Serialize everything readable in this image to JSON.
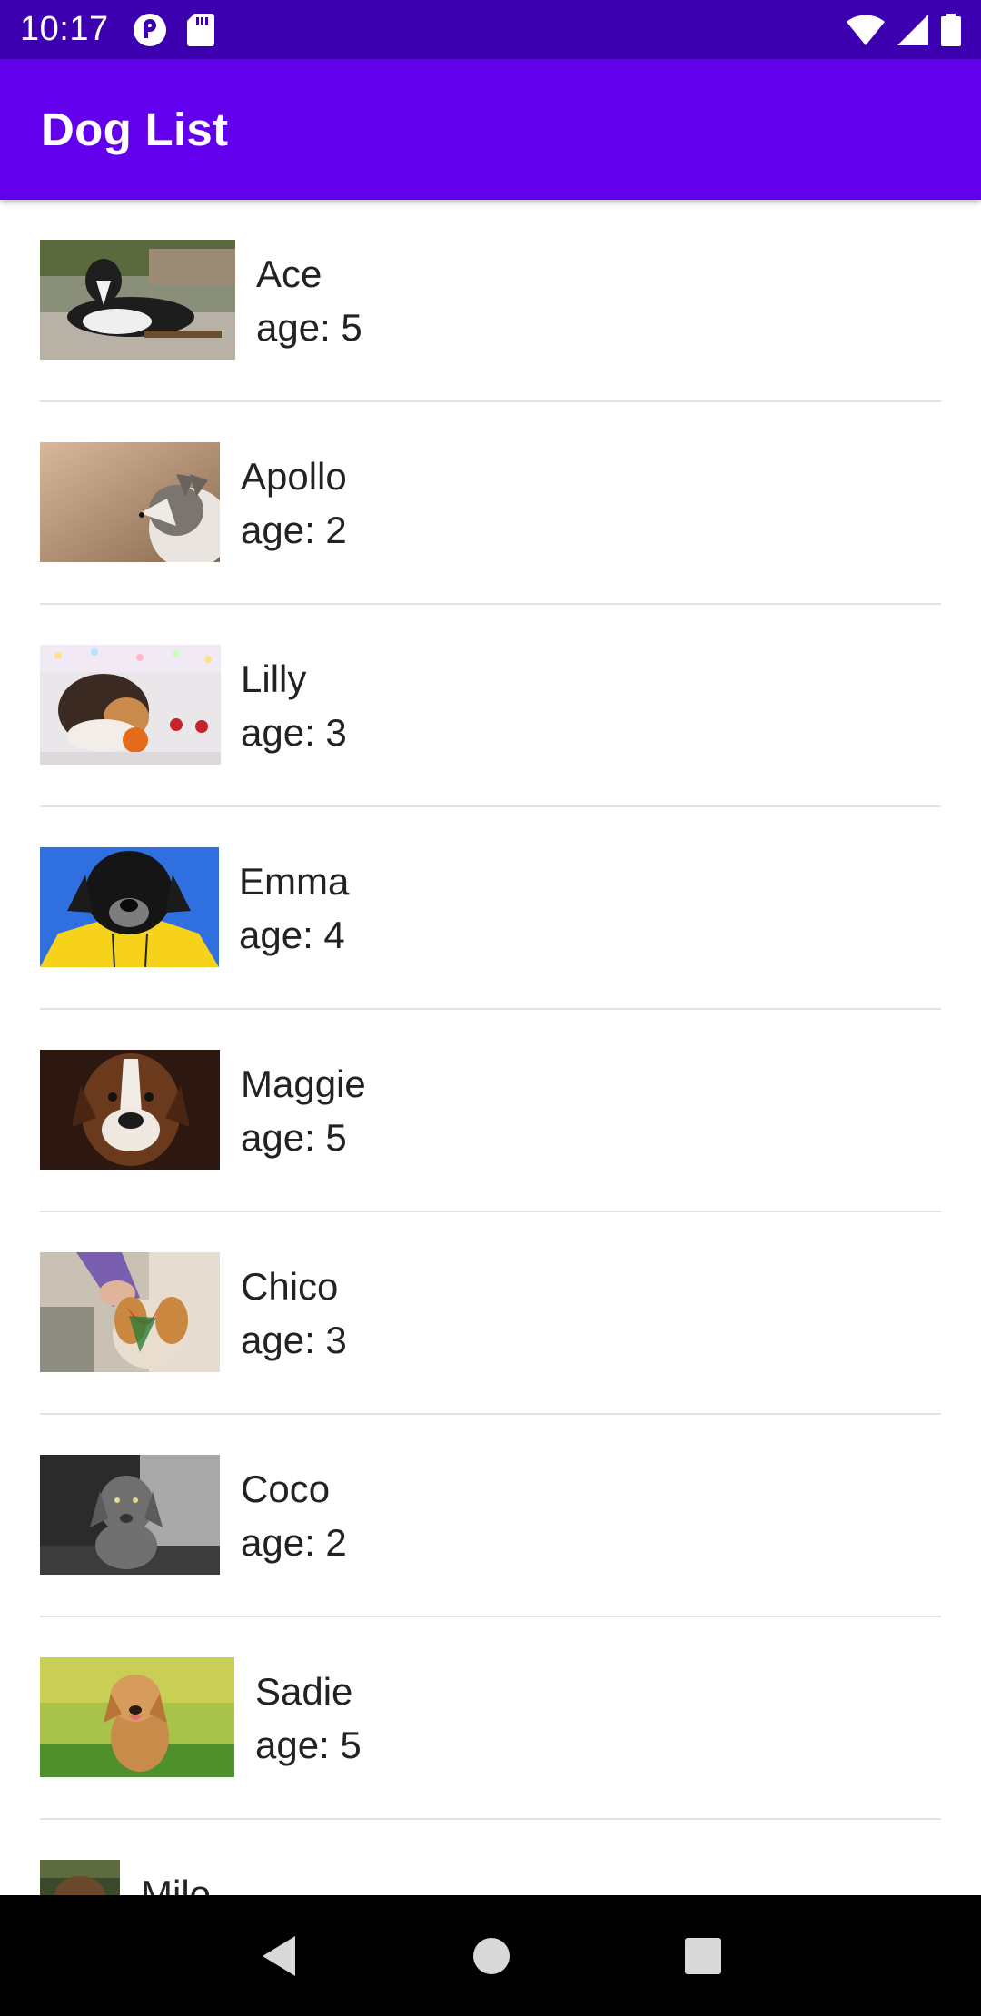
{
  "status_bar": {
    "time": "10:17",
    "icons": [
      "pocket-casts-icon",
      "sd-card-icon",
      "wifi-icon",
      "signal-icon",
      "battery-icon"
    ]
  },
  "app_bar": {
    "title": "Dog List"
  },
  "dogs": [
    {
      "name": "Ace",
      "age": "age: 5",
      "photo": "border-collie-photo"
    },
    {
      "name": "Apollo",
      "age": "age: 2",
      "photo": "husky-photo"
    },
    {
      "name": "Lilly",
      "age": "age: 3",
      "photo": "sheltie-photo"
    },
    {
      "name": "Emma",
      "age": "age: 4",
      "photo": "black-lab-raincoat-photo"
    },
    {
      "name": "Maggie",
      "age": "age: 5",
      "photo": "boxer-photo"
    },
    {
      "name": "Chico",
      "age": "age: 3",
      "photo": "puppy-with-toy-photo"
    },
    {
      "name": "Coco",
      "age": "age: 2",
      "photo": "weimaraner-puppy-photo"
    },
    {
      "name": "Sadie",
      "age": "age: 5",
      "photo": "golden-puppy-photo"
    },
    {
      "name": "Milo",
      "age": "",
      "photo": "dog-photo"
    }
  ],
  "nav_bar": {
    "buttons": [
      "back-icon",
      "home-icon",
      "recents-icon"
    ]
  },
  "colors": {
    "status_bar": "#3d00b1",
    "app_bar": "#6200ee",
    "divider": "#e3e3e3",
    "nav_bar": "#000000"
  }
}
